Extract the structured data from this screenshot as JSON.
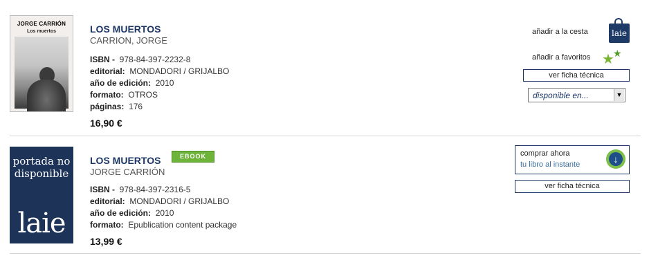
{
  "results": [
    {
      "cover": {
        "line1": "JORGE CARRIÓN",
        "line2": "Los muertos"
      },
      "title": "LOS MUERTOS",
      "author": "CARRION, JORGE",
      "isbn_label": "ISBN -",
      "isbn": "978-84-397-2232-8",
      "editorial_label": "editorial:",
      "editorial": "MONDADORI / GRIJALBO",
      "year_label": "año de edición:",
      "year": "2010",
      "format_label": "formato:",
      "format": "OTROS",
      "pages_label": "páginas:",
      "pages": "176",
      "price": "16,90 €",
      "actions": {
        "add_to_cart": "añadir a la cesta",
        "bag_brand": "laie",
        "add_to_favorites": "añadir a favoritos",
        "tech_sheet": "ver ficha técnica",
        "availability": "disponible en..."
      }
    },
    {
      "cover": {
        "placeholder": "portada no disponible",
        "logo": "laie"
      },
      "title": "LOS MUERTOS",
      "badge": "EBOOK",
      "author": "JORGE CARRIÓN",
      "isbn_label": "ISBN -",
      "isbn": "978-84-397-2316-5",
      "editorial_label": "editorial:",
      "editorial": "MONDADORI / GRIJALBO",
      "year_label": "año de edición:",
      "year": "2010",
      "format_label": "formato:",
      "format": "Epublication content package",
      "price": "13,99 €",
      "actions": {
        "buy_now": "comprar ahora",
        "buy_now_sub": "tu libro al instante",
        "tech_sheet": "ver ficha técnica"
      }
    }
  ],
  "colors": {
    "title": "#1c3665",
    "ebook_badge": "#6eb43b",
    "brand_navy": "#1d3357"
  },
  "icons": [
    "shopping-bag-icon",
    "favorite-stars-icon",
    "dropdown-arrow-icon",
    "download-icon"
  ]
}
